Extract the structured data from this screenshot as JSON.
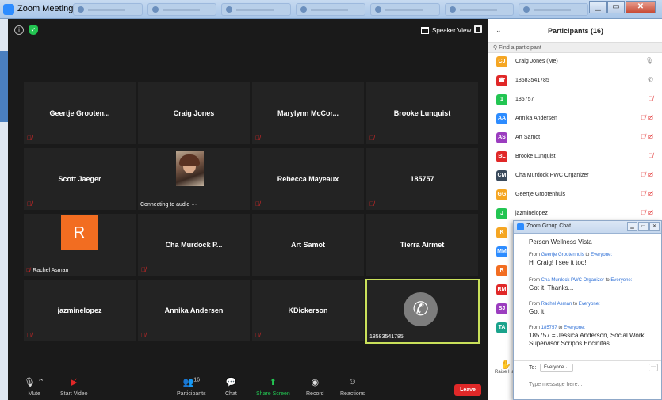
{
  "window": {
    "title": "Zoom Meeting"
  },
  "colors": {
    "accent": "#2d8cff",
    "leave": "#e02828",
    "share": "#23c552",
    "active_border": "#c9e05a"
  },
  "video": {
    "view_label": "Speaker View",
    "tiles": [
      {
        "name": "Geertje Grooten...",
        "muted": true
      },
      {
        "name": "Craig Jones",
        "muted": false
      },
      {
        "name": "Marylynn McCor...",
        "muted": true
      },
      {
        "name": "Brooke Lunquist",
        "muted": true
      },
      {
        "name": "Scott Jaeger",
        "muted": true
      },
      {
        "name": "",
        "caption": "Connecting to audio ···",
        "has_photo": true
      },
      {
        "name": "Rebecca Mayeaux",
        "muted": true
      },
      {
        "name": "185757",
        "muted": true
      },
      {
        "name": "",
        "caption": "Rachel Asman",
        "avatar_letter": "R",
        "muted": true
      },
      {
        "name": "Cha Murdock P...",
        "muted": true
      },
      {
        "name": "Art Samot",
        "muted": false
      },
      {
        "name": "Tierra Airmet",
        "muted": false
      },
      {
        "name": "jazminelopez",
        "muted": true
      },
      {
        "name": "Annika Andersen",
        "muted": true
      },
      {
        "name": "KDickerson",
        "muted": true
      },
      {
        "name": "",
        "caption": "18583541785",
        "phone": true,
        "active": true
      }
    ]
  },
  "toolbar": {
    "mute": "Mute",
    "start_video": "Start Video",
    "participants": "Participants",
    "participants_count": "16",
    "chat": "Chat",
    "share_screen": "Share Screen",
    "record": "Record",
    "reactions": "Reactions",
    "leave": "Leave"
  },
  "participants": {
    "title": "Participants (16)",
    "search_placeholder": "Find a participant",
    "raise_hand": "Raise Han",
    "items": [
      {
        "initials": "CJ",
        "name": "Craig Jones (Me)",
        "color": "#f5a623"
      },
      {
        "initials": "☎",
        "name": "18583541785",
        "color": "#e02828"
      },
      {
        "initials": "1",
        "name": "185757",
        "color": "#23c552"
      },
      {
        "initials": "AA",
        "name": "Annika Andersen",
        "color": "#2d8cff"
      },
      {
        "initials": "AS",
        "name": "Art Samot",
        "color": "#9b3dbf"
      },
      {
        "initials": "BL",
        "name": "Brooke Lunquist",
        "color": "#e02828"
      },
      {
        "initials": "CM",
        "name": "Cha Murdock PWC Organizer",
        "color": "#3a4a5c"
      },
      {
        "initials": "GG",
        "name": "Geertje Grootenhuis",
        "color": "#f5a623"
      },
      {
        "initials": "J",
        "name": "jazminelopez",
        "color": "#23c552"
      },
      {
        "initials": "K",
        "name": "K",
        "color": "#f5a623"
      },
      {
        "initials": "MM",
        "name": "M",
        "color": "#2d8cff"
      },
      {
        "initials": "R",
        "name": "R",
        "color": "#f26d21"
      },
      {
        "initials": "RM",
        "name": "R",
        "color": "#e02828"
      },
      {
        "initials": "SJ",
        "name": "S",
        "color": "#9b3dbf"
      },
      {
        "initials": "TA",
        "name": "T",
        "color": "#1aa38c"
      }
    ]
  },
  "chat": {
    "title": "Zoom Group Chat",
    "messages": [
      {
        "from": "",
        "to": "",
        "text": "Person Wellness Vista"
      },
      {
        "from": "Geertje Grootenhuis",
        "to": "Everyone",
        "text": "Hi Craig! I see it too!"
      },
      {
        "from": "Cha Murdock PWC Organizer",
        "to": "Everyone",
        "text": "Got it. Thanks..."
      },
      {
        "from": "Rachel Asman",
        "to": "Everyone",
        "text": "Got it."
      },
      {
        "from": "185757",
        "to": "Everyone",
        "text": "185757 = Jessica Anderson, Social Work Supervisor Scripps Encinitas."
      }
    ],
    "from_prefix": "From",
    "to_word": "to",
    "to_label": "To:",
    "to_value": "Everyone ⌄",
    "more": "···",
    "placeholder": "Type message here..."
  }
}
